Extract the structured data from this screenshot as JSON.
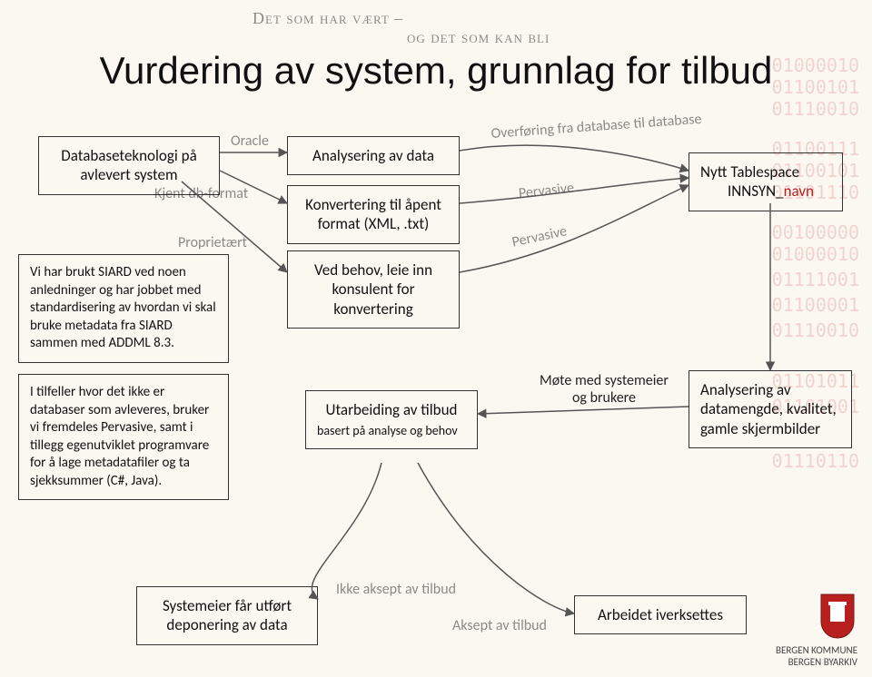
{
  "watermark": {
    "line1": "Det som har vært –",
    "line2": "og det som kan bli"
  },
  "binary_lines": [
    "01000010",
    "01100101",
    "01110010",
    "01100111",
    "01100101",
    "01101110",
    "00100000",
    "01000010",
    "01111001",
    "01100001",
    "01110010",
    "01101011",
    "01101001",
    "01110110"
  ],
  "title": "Vurdering av system, grunnlag for tilbud",
  "nodes": {
    "db_tech": "Databaseteknologi på avlevert system",
    "analyse_data": "Analysering av data",
    "convert_xml": "Konvertering til åpent format (XML, .txt)",
    "lease_consultant": "Ved behov, leie inn konsulent for konvertering",
    "tablespace": {
      "label": "Nytt Tablespace",
      "name": "INNSYN_navn"
    },
    "analyse_volume": "Analysering av datamengde, kvalitet, gamle skjermbilder",
    "tilbud": {
      "label": "Utarbeiding av tilbud",
      "sub": "basert på analyse og behov"
    },
    "deponering": "Systemeier får utført deponering av data",
    "iverksettes": "Arbeidet iverksettes"
  },
  "asides": {
    "a1": "Vi har brukt SIARD ved noen anledninger og har jobbet med standardisering av hvordan vi skal bruke metadata fra SIARD sammen med ADDML 8.3.",
    "a2": "I tilfeller hvor det ikke er databaser som avleveres, bruker vi fremdeles Pervasive, samt i tillegg egenutviklet programvare for å lage metadatafiler og ta sjekksummer (C#, Java)."
  },
  "edge_labels": {
    "oracle": "Oracle",
    "kjent": "Kjent db-format",
    "proprietaert": "Proprietært",
    "overforing": "Overføring fra database til database",
    "pervasive": "Pervasive",
    "mote": "Møte med systemeier og brukere",
    "ikke_aksept": "Ikke aksept av tilbud",
    "aksept": "Aksept av tilbud"
  },
  "logo": {
    "line1": "BERGEN KOMMUNE",
    "line2": "BERGEN BYARKIV"
  }
}
